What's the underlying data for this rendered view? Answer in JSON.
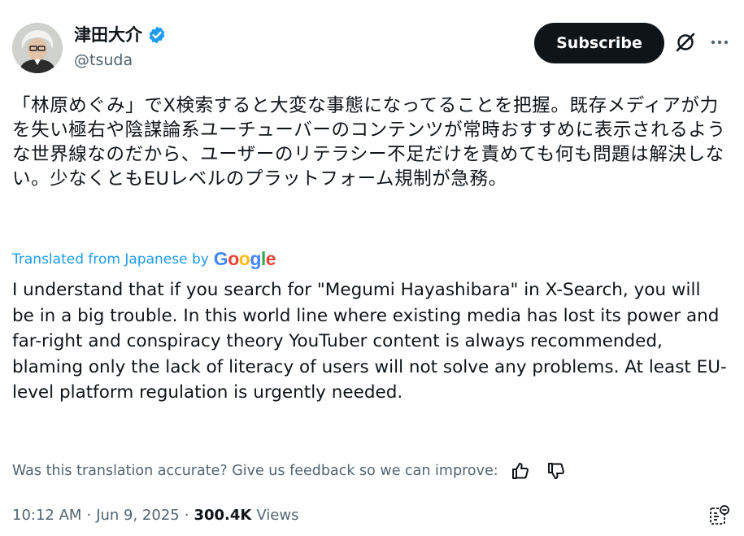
{
  "author": {
    "display_name": "津田大介",
    "handle": "@tsuda",
    "verified": true,
    "verified_color": "#1d9bf0"
  },
  "header": {
    "subscribe_label": "Subscribe",
    "grok_icon": "grok-slash-icon",
    "more_icon": "more-dots-icon"
  },
  "tweet": {
    "original_text": "「林原めぐみ」でX検索すると大変な事態になってることを把握。既存メディアが力を失い極右や陰謀論系ユーチューバーのコンテンツが常時おすすめに表示されるような世界線なのだから、ユーザーのリテラシー不足だけを責めても何も問題は解決しない。少なくともEUレベルのプラットフォーム規制が急務。",
    "translated_from_label": "Translated from Japanese by",
    "translation_provider": "Google",
    "translation_text": "I understand that if you search for \"Megumi Hayashibara\" in X-Search, you will be in a big trouble. In this world line where existing media has lost its power and far-right and conspiracy theory YouTuber content is always recommended, blaming only the lack of literacy of users will not solve any problems. At least EU-level platform regulation is urgently needed."
  },
  "feedback": {
    "question": "Was this translation accurate? Give us feedback so we can improve:",
    "thumbs_up_icon": "thumbs-up-icon",
    "thumbs_down_icon": "thumbs-down-icon"
  },
  "meta": {
    "time": "10:12 AM",
    "separator": "·",
    "date": "Jun 9, 2025",
    "views_count": "300.4K",
    "views_label": "Views",
    "analytics_icon": "analytics-icon"
  },
  "colors": {
    "link": "#1d9bf0",
    "muted": "#536471",
    "text": "#0f1419"
  }
}
